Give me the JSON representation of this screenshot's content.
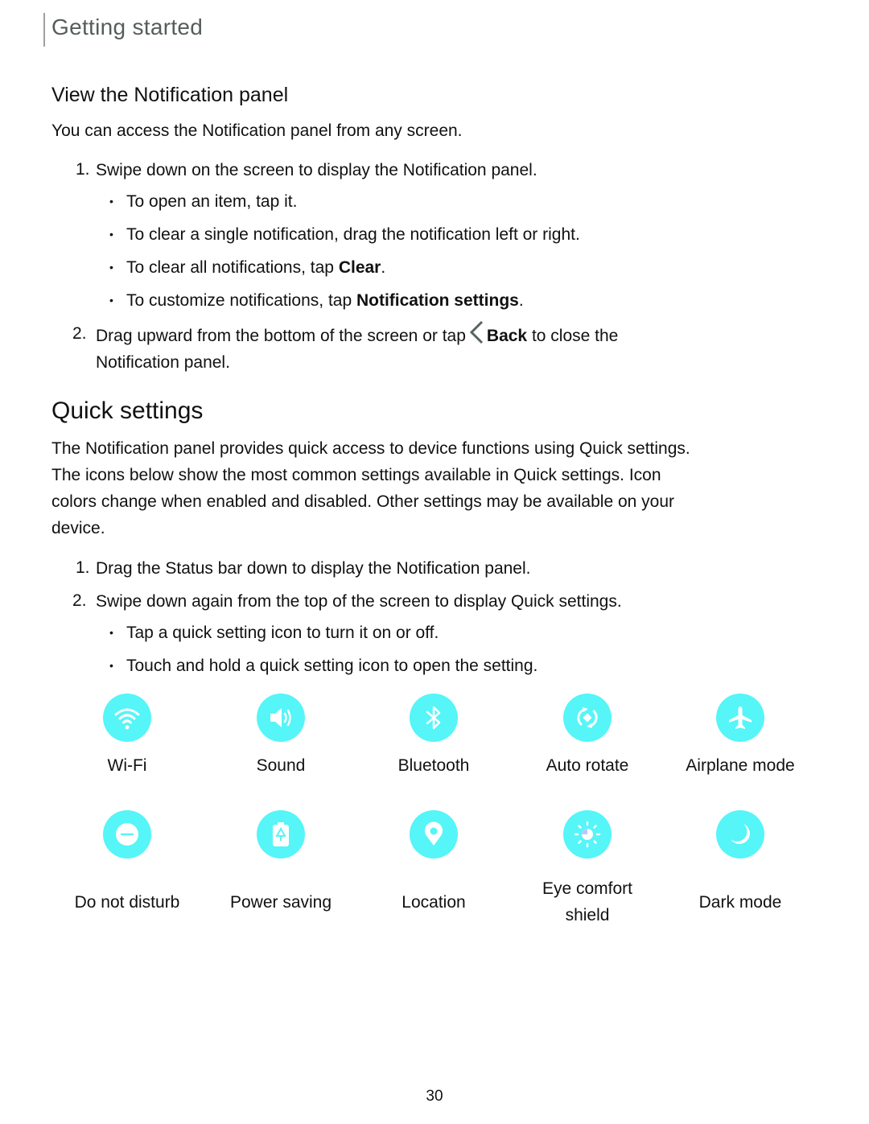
{
  "header": {
    "section": "Getting started"
  },
  "notification_panel": {
    "heading": "View the Notification panel",
    "intro": "You can access the Notification panel from any screen.",
    "step1": {
      "num": "1.",
      "text": "Swipe down on the screen to display the Notification panel."
    },
    "bullets": [
      {
        "text": "To open an item, tap it."
      },
      {
        "text": "To clear a single notification, drag the notification left or right."
      },
      {
        "pre": "To clear all notifications, tap ",
        "bold": "Clear",
        "post": "."
      },
      {
        "pre": "To customize notifications, tap ",
        "bold": "Notification settings",
        "post": "."
      }
    ],
    "step2": {
      "num": "2.",
      "pre": "Drag upward from the bottom of the screen or tap",
      "bold": "Back",
      "post": " to close the",
      "line2": "Notification panel."
    }
  },
  "quick_settings": {
    "heading": "Quick settings",
    "intro": [
      "The Notification panel provides quick access to device functions using Quick settings.",
      "The icons below show the most common settings available in Quick settings. Icon",
      "colors change when enabled and disabled. Other settings may be available on your",
      "device."
    ],
    "step1": {
      "num": "1.",
      "text": "Drag the Status bar down to display the Notification panel."
    },
    "step2": {
      "num": "2.",
      "text": "Swipe down again from the top of the screen to display Quick settings."
    },
    "bullets": [
      "Tap a quick setting icon to turn it on or off.",
      "Touch and hold a quick setting icon to open the setting."
    ],
    "icon_color": "#55f5f8",
    "tiles_row1": [
      {
        "label": "Wi-Fi",
        "icon": "wifi-icon"
      },
      {
        "label": "Sound",
        "icon": "sound-icon"
      },
      {
        "label": "Bluetooth",
        "icon": "bluetooth-icon"
      },
      {
        "label": "Auto rotate",
        "icon": "auto-rotate-icon"
      },
      {
        "label": "Airplane mode",
        "icon": "airplane-icon"
      }
    ],
    "tiles_row2": [
      {
        "label": "Do not disturb",
        "icon": "do-not-disturb-icon"
      },
      {
        "label": "Power saving",
        "icon": "power-saving-icon"
      },
      {
        "label": "Location",
        "icon": "location-icon"
      },
      {
        "label": "Eye comfort",
        "label2": "shield",
        "icon": "eye-comfort-icon"
      },
      {
        "label": "Dark mode",
        "icon": "dark-mode-icon"
      }
    ]
  },
  "page_number": "30"
}
